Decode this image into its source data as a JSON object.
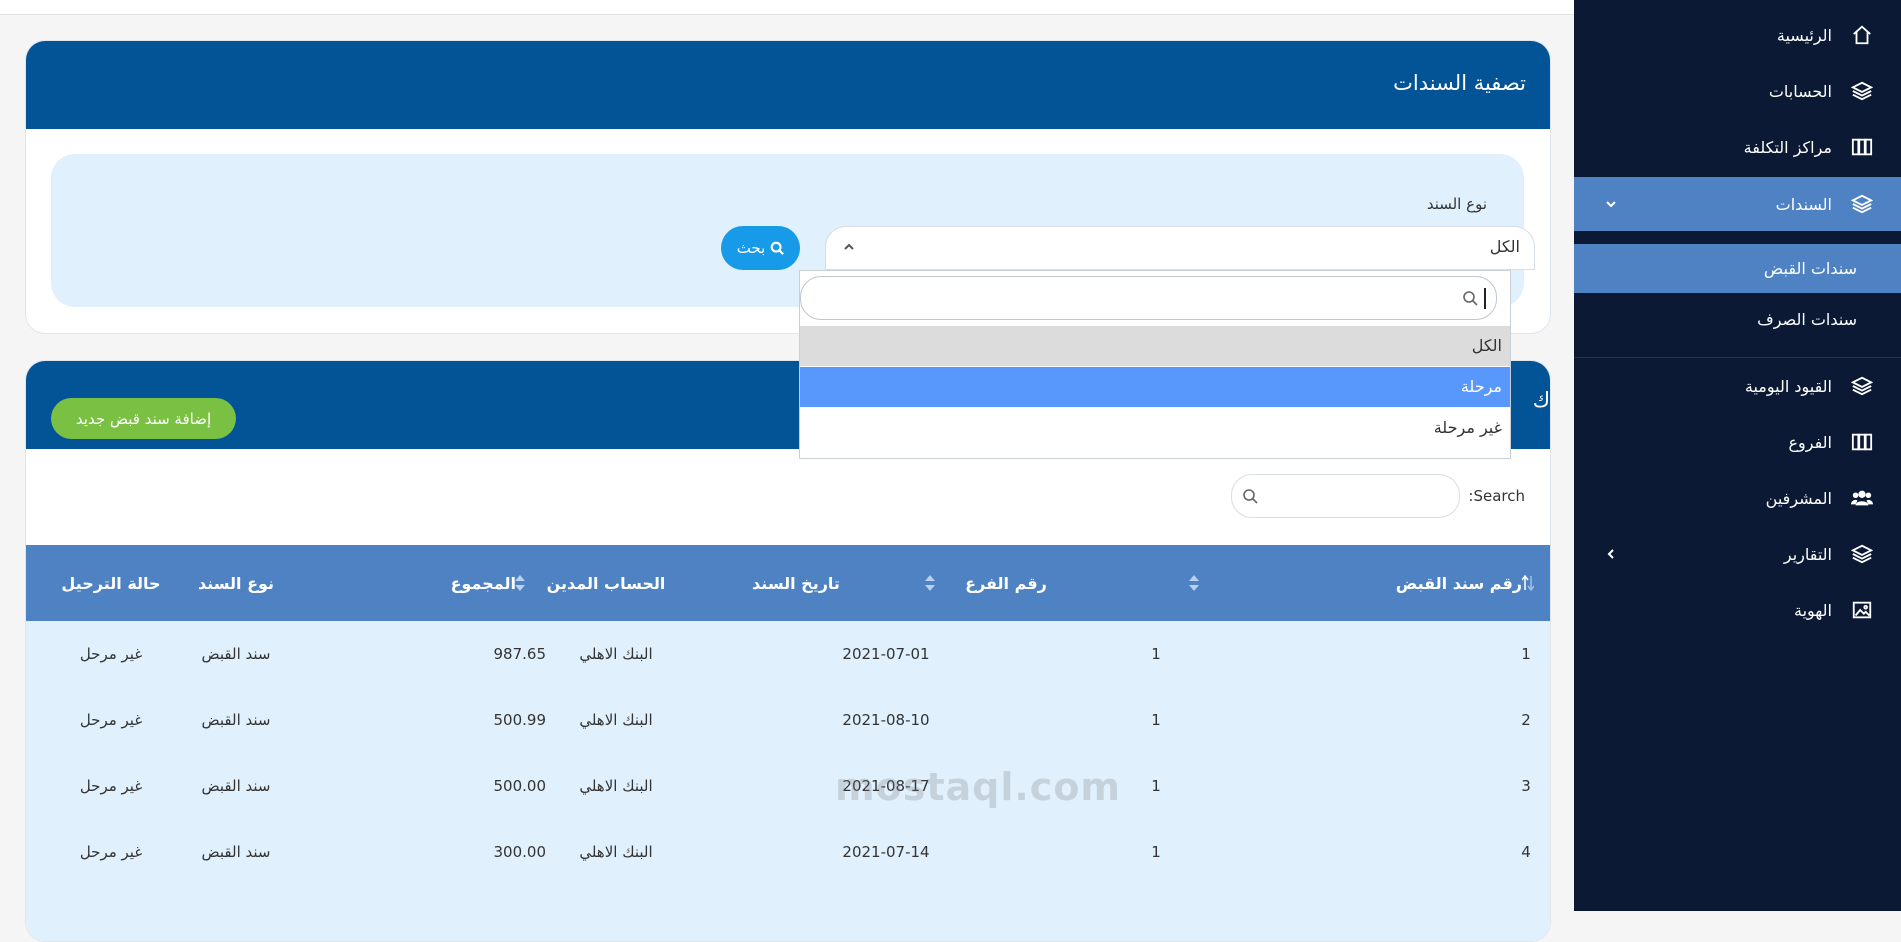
{
  "sidebar": {
    "items": [
      {
        "label": "الرئيسية",
        "icon": "home-icon"
      },
      {
        "label": "الحسابات",
        "icon": "layers-icon"
      },
      {
        "label": "مراكز التكلفة",
        "icon": "columns-icon"
      },
      {
        "label": "السندات",
        "icon": "layers-icon",
        "expanded": true
      },
      {
        "label": "القيود اليومية",
        "icon": "layers-icon"
      },
      {
        "label": "الفروع",
        "icon": "columns-icon"
      },
      {
        "label": "المشرفين",
        "icon": "users-icon"
      },
      {
        "label": "التقارير",
        "icon": "layers-icon"
      },
      {
        "label": "الهوية",
        "icon": "image-icon"
      }
    ],
    "subitems": [
      {
        "label": "سندات القبض",
        "active": true
      },
      {
        "label": "سندات الصرف",
        "active": false
      }
    ],
    "colors": {
      "background": "#0b1934",
      "active": "#4e82c2"
    }
  },
  "filter": {
    "title": "تصفية السندات",
    "field_label": "نوع السند",
    "selected_value": "الكل",
    "search_button": "بحث",
    "dropdown_search_placeholder": "",
    "options": [
      "الكل",
      "مرحلة",
      "غير مرحلة"
    ],
    "highlighted_option": "مرحلة"
  },
  "table_card": {
    "title_peek": "ك",
    "add_button": "إضافة سند قبض جديد",
    "search_label": "Search:",
    "search_value": "",
    "columns": [
      "رقم سند القبض",
      "رقم الفرع",
      "تاريخ السند",
      "الحساب المدين",
      "المجموع",
      "نوع السند",
      "حالة الترحيل"
    ],
    "rows": [
      [
        "1",
        "1",
        "2021-07-01",
        "البنك الاهلي",
        "987.65",
        "سند القبض",
        "غير مرحل"
      ],
      [
        "2",
        "1",
        "2021-08-10",
        "البنك الاهلي",
        "500.99",
        "سند القبض",
        "غير مرحل"
      ],
      [
        "3",
        "1",
        "2021-08-17",
        "البنك الاهلي",
        "500.00",
        "سند القبض",
        "غير مرحل"
      ],
      [
        "4",
        "1",
        "2021-07-14",
        "البنك الاهلي",
        "300.00",
        "سند القبض",
        "غير مرحل"
      ]
    ]
  },
  "watermark": "mostaql.com",
  "colors": {
    "header": "#025496",
    "table_head": "#4e82c2",
    "row": "#e1f0fd",
    "search_btn": "#179be9",
    "add_btn": "#7ac043",
    "dropdown_selected": "#5897fb"
  }
}
